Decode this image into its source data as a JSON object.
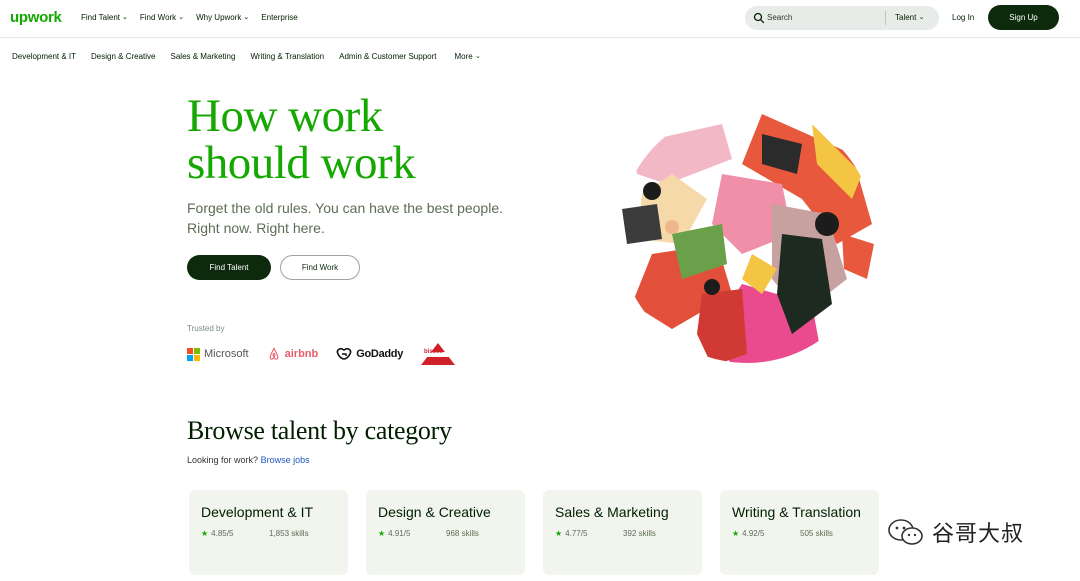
{
  "brand": {
    "logo": "upwork",
    "accent": "#14a800",
    "dark": "#0d2a0d"
  },
  "nav": {
    "links": [
      "Find Talent",
      "Find Work",
      "Why Upwork",
      "Enterprise"
    ],
    "search_placeholder": "Search",
    "search_scope": "Talent",
    "login": "Log In",
    "signup": "Sign Up"
  },
  "categories_nav": {
    "items": [
      "Development & IT",
      "Design & Creative",
      "Sales & Marketing",
      "Writing & Translation",
      "Admin & Customer Support"
    ],
    "more": "More"
  },
  "hero": {
    "title_line1": "How work",
    "title_line2": "should work",
    "subtitle_line1": "Forget the old rules. You can have the best people.",
    "subtitle_line2": "Right now. Right here.",
    "btn_find_talent": "Find Talent",
    "btn_find_work": "Find Work",
    "trusted_by": "Trusted by",
    "trusted_logos": [
      "Microsoft",
      "airbnb",
      "GoDaddy",
      "bissell"
    ]
  },
  "browse": {
    "title": "Browse talent by category",
    "sub_text": "Looking for work?",
    "sub_link": "Browse jobs",
    "cards": [
      {
        "title": "Development & IT",
        "rating": "4.85/5",
        "skills": "1,853 skills"
      },
      {
        "title": "Design & Creative",
        "rating": "4.91/5",
        "skills": "968 skills"
      },
      {
        "title": "Sales & Marketing",
        "rating": "4.77/5",
        "skills": "392 skills"
      },
      {
        "title": "Writing & Translation",
        "rating": "4.92/5",
        "skills": "505 skills"
      }
    ]
  },
  "watermark": {
    "text": "谷哥大叔"
  }
}
